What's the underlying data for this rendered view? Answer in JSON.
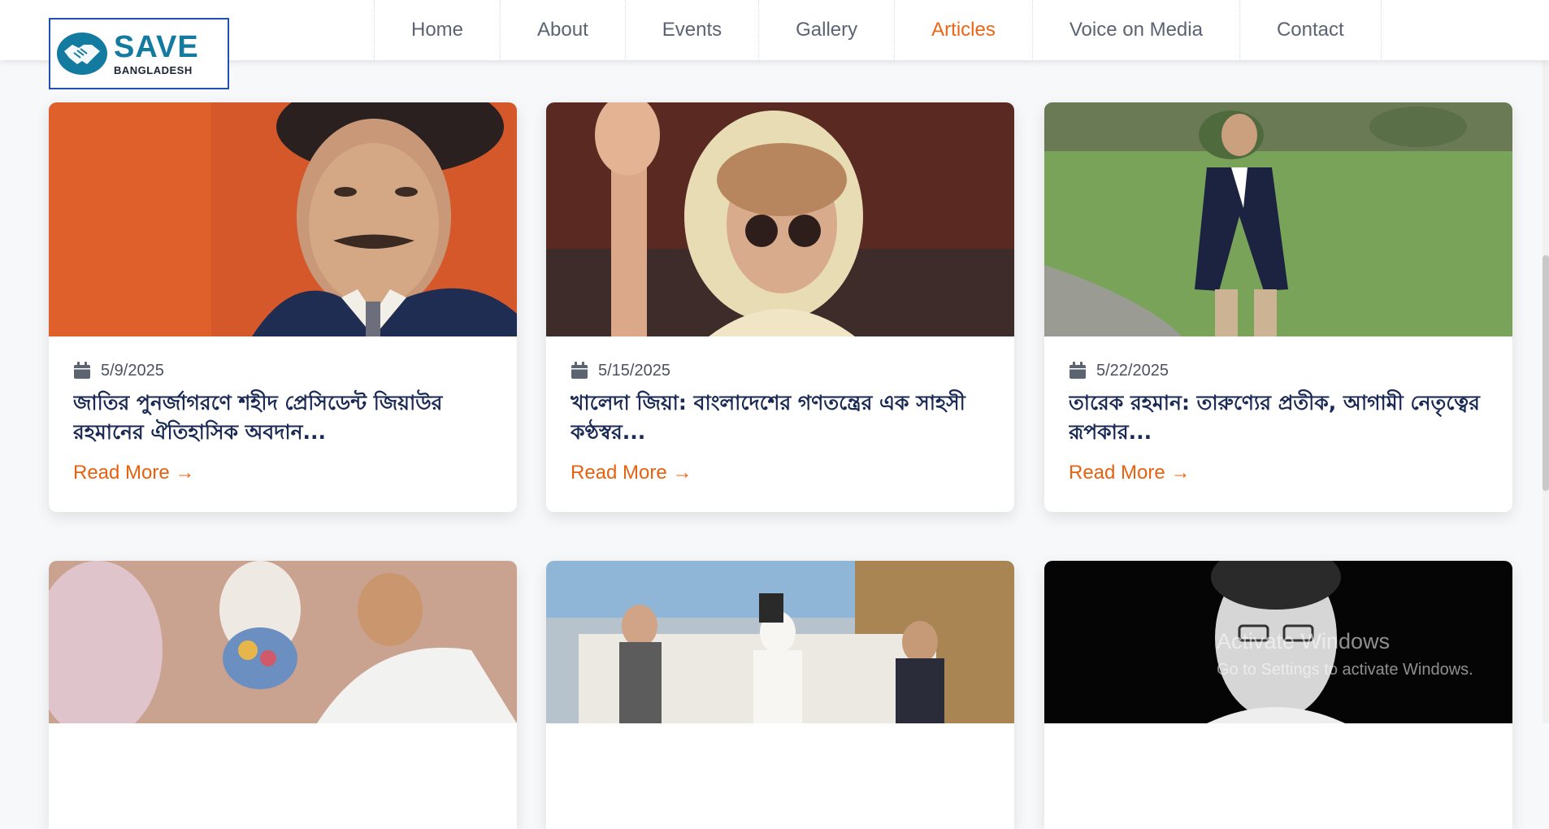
{
  "nav": {
    "items": [
      {
        "label": "Home",
        "active": false
      },
      {
        "label": "About",
        "active": false
      },
      {
        "label": "Events",
        "active": false
      },
      {
        "label": "Gallery",
        "active": false
      },
      {
        "label": "Articles",
        "active": true
      },
      {
        "label": "Voice on Media",
        "active": false
      },
      {
        "label": "Contact",
        "active": false
      }
    ]
  },
  "logo": {
    "title": "SAVE",
    "subtitle": "BANGLADESH",
    "icon": "handshake-icon"
  },
  "articles": [
    {
      "date": "5/9/2025",
      "title": "জাতির পুনর্জাগরণে শহীদ প্রেসিডেন্ট জিয়াউর রহমানের ঐতিহাসিক অবদান...",
      "read_more": "Read More →"
    },
    {
      "date": "5/15/2025",
      "title": "খালেদা জিয়া: বাংলাদেশের গণতন্ত্রের এক সাহসী কণ্ঠস্বর...",
      "read_more": "Read More →"
    },
    {
      "date": "5/22/2025",
      "title": "তারেক রহমান: তারুণ্যের প্রতীক, আগামী নেতৃত্বের রূপকার...",
      "read_more": "Read More →"
    }
  ],
  "watermark": {
    "line1": "Activate Windows",
    "line2": "Go to Settings to activate Windows."
  },
  "colors": {
    "accent": "#f06414",
    "title": "#1a2a55",
    "logo": "#137aa0"
  }
}
